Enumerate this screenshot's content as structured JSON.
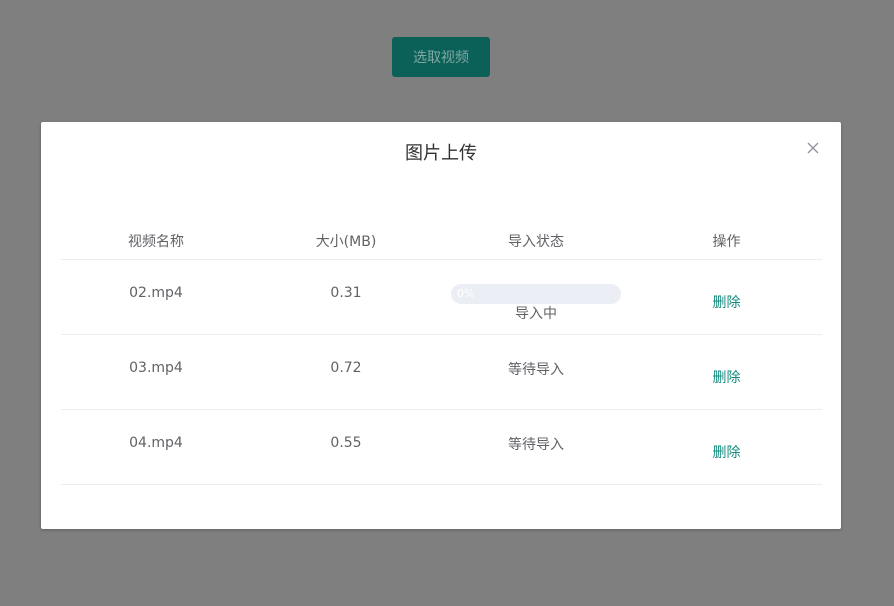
{
  "toolbar": {
    "select_video_label": "选取视频"
  },
  "dialog": {
    "title": "图片上传",
    "columns": [
      "视频名称",
      "大小(MB)",
      "导入状态",
      "操作"
    ],
    "rows": [
      {
        "name": "02.mp4",
        "size": "0.31",
        "progress": "0%",
        "progress_fraction": 0,
        "status": "导入中",
        "action": "删除"
      },
      {
        "name": "03.mp4",
        "size": "0.72",
        "status": "等待导入",
        "action": "删除"
      },
      {
        "name": "04.mp4",
        "size": "0.55",
        "status": "等待导入",
        "action": "删除"
      }
    ]
  },
  "colors": {
    "accent": "#0b6158",
    "link": "#128a7c",
    "overlay": "#7f7f7f"
  },
  "icons": {
    "close": "close-icon"
  }
}
